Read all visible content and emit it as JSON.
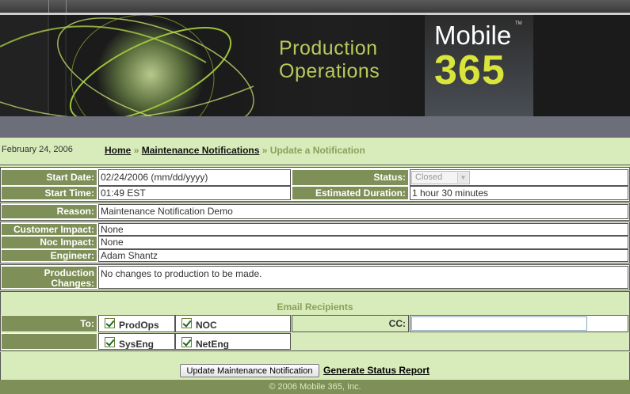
{
  "header": {
    "title_line1": "Production",
    "title_line2": "Operations",
    "logo_word": "Mobile",
    "logo_tm": "TM",
    "logo_number": "365"
  },
  "breadcrumb": {
    "date": "February 24, 2006",
    "home": "Home",
    "sep1": "»",
    "section": "Maintenance Notifications",
    "sep2": "»",
    "current": "Update a Notification"
  },
  "form": {
    "start_date_label": "Start Date:",
    "start_date_value": "02/24/2006 (mm/dd/yyyy)",
    "status_label": "Status:",
    "status_value": "Closed",
    "start_time_label": "Start Time:",
    "start_time_value": "01:49 EST",
    "duration_label": "Estimated Duration:",
    "duration_value": "1 hour 30 minutes",
    "reason_label": "Reason:",
    "reason_value": "Maintenance Notification Demo",
    "customer_impact_label": "Customer Impact:",
    "customer_impact_value": "None",
    "noc_impact_label": "Noc Impact:",
    "noc_impact_value": "None",
    "engineer_label": "Engineer:",
    "engineer_value": "Adam Shantz",
    "production_label_1": "Production",
    "production_label_2": "Changes:",
    "production_value": "No changes to production to be made."
  },
  "email": {
    "heading": "Email Recipients",
    "to_label": "To:",
    "cc_label": "CC:",
    "cc_value": "",
    "recipients": [
      {
        "label": "ProdOps",
        "checked": true
      },
      {
        "label": "NOC",
        "checked": true
      },
      {
        "label": "SysEng",
        "checked": true
      },
      {
        "label": "NetEng",
        "checked": true
      }
    ]
  },
  "actions": {
    "update_button": "Update Maintenance Notification",
    "status_report_link": "Generate Status Report"
  },
  "footer": {
    "copyright": "© 2006 Mobile 365, Inc."
  },
  "colors": {
    "label_bg": "#7f8f58",
    "page_bg": "#d8ebba",
    "accent": "#b9c95a"
  }
}
